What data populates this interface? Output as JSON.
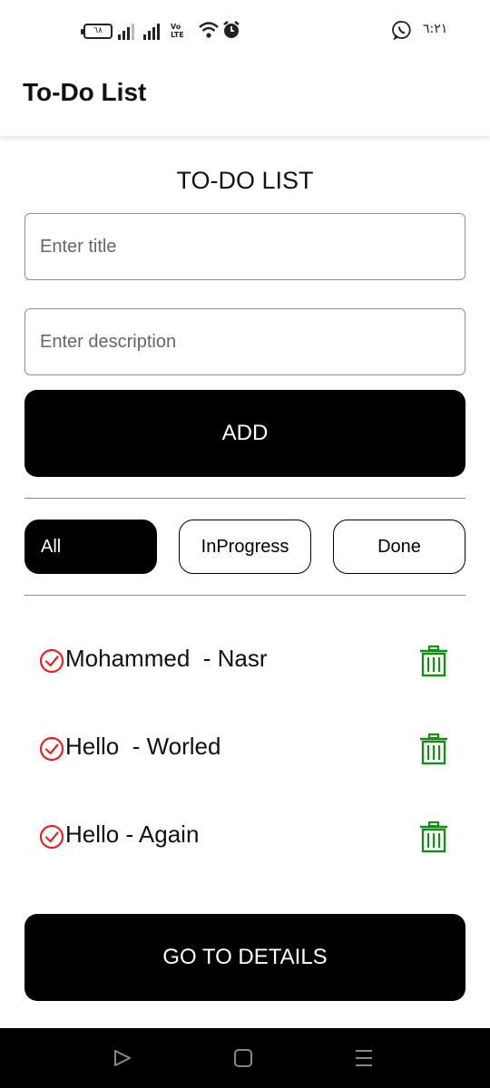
{
  "status_bar": {
    "battery_level": "٦٨",
    "time": "٦:٢١",
    "icons": [
      "battery-icon",
      "signal-icon",
      "signal-icon",
      "volte-icon",
      "wifi-icon",
      "alarm-icon",
      "whatsapp-icon"
    ],
    "volte_line1": "Vo",
    "volte_line2": "LTE"
  },
  "app_bar": {
    "title": "To-Do List"
  },
  "form": {
    "heading": "TO-DO LIST",
    "title_placeholder": "Enter title",
    "title_value": "",
    "description_placeholder": "Enter description",
    "description_value": "",
    "add_label": "ADD"
  },
  "filters": [
    {
      "label": "All",
      "active": true
    },
    {
      "label": "InProgress",
      "active": false
    },
    {
      "label": "Done",
      "active": false
    }
  ],
  "todos": [
    {
      "text": "Mohammed  - Nasr",
      "status_icon": "check-circle-icon",
      "delete_icon": "trash-icon"
    },
    {
      "text": "Hello  - Worled",
      "status_icon": "check-circle-icon",
      "delete_icon": "trash-icon"
    },
    {
      "text": "Hello - Again",
      "status_icon": "check-circle-icon",
      "delete_icon": "trash-icon"
    }
  ],
  "details_button_label": "GO TO DETAILS",
  "nav_bar": {
    "icons": [
      "back-icon",
      "home-icon",
      "recents-icon"
    ]
  },
  "colors": {
    "accent_check": "#e02424",
    "accent_delete": "#1a8a1a",
    "primary_button": "#000000",
    "background": "#ffffff"
  }
}
